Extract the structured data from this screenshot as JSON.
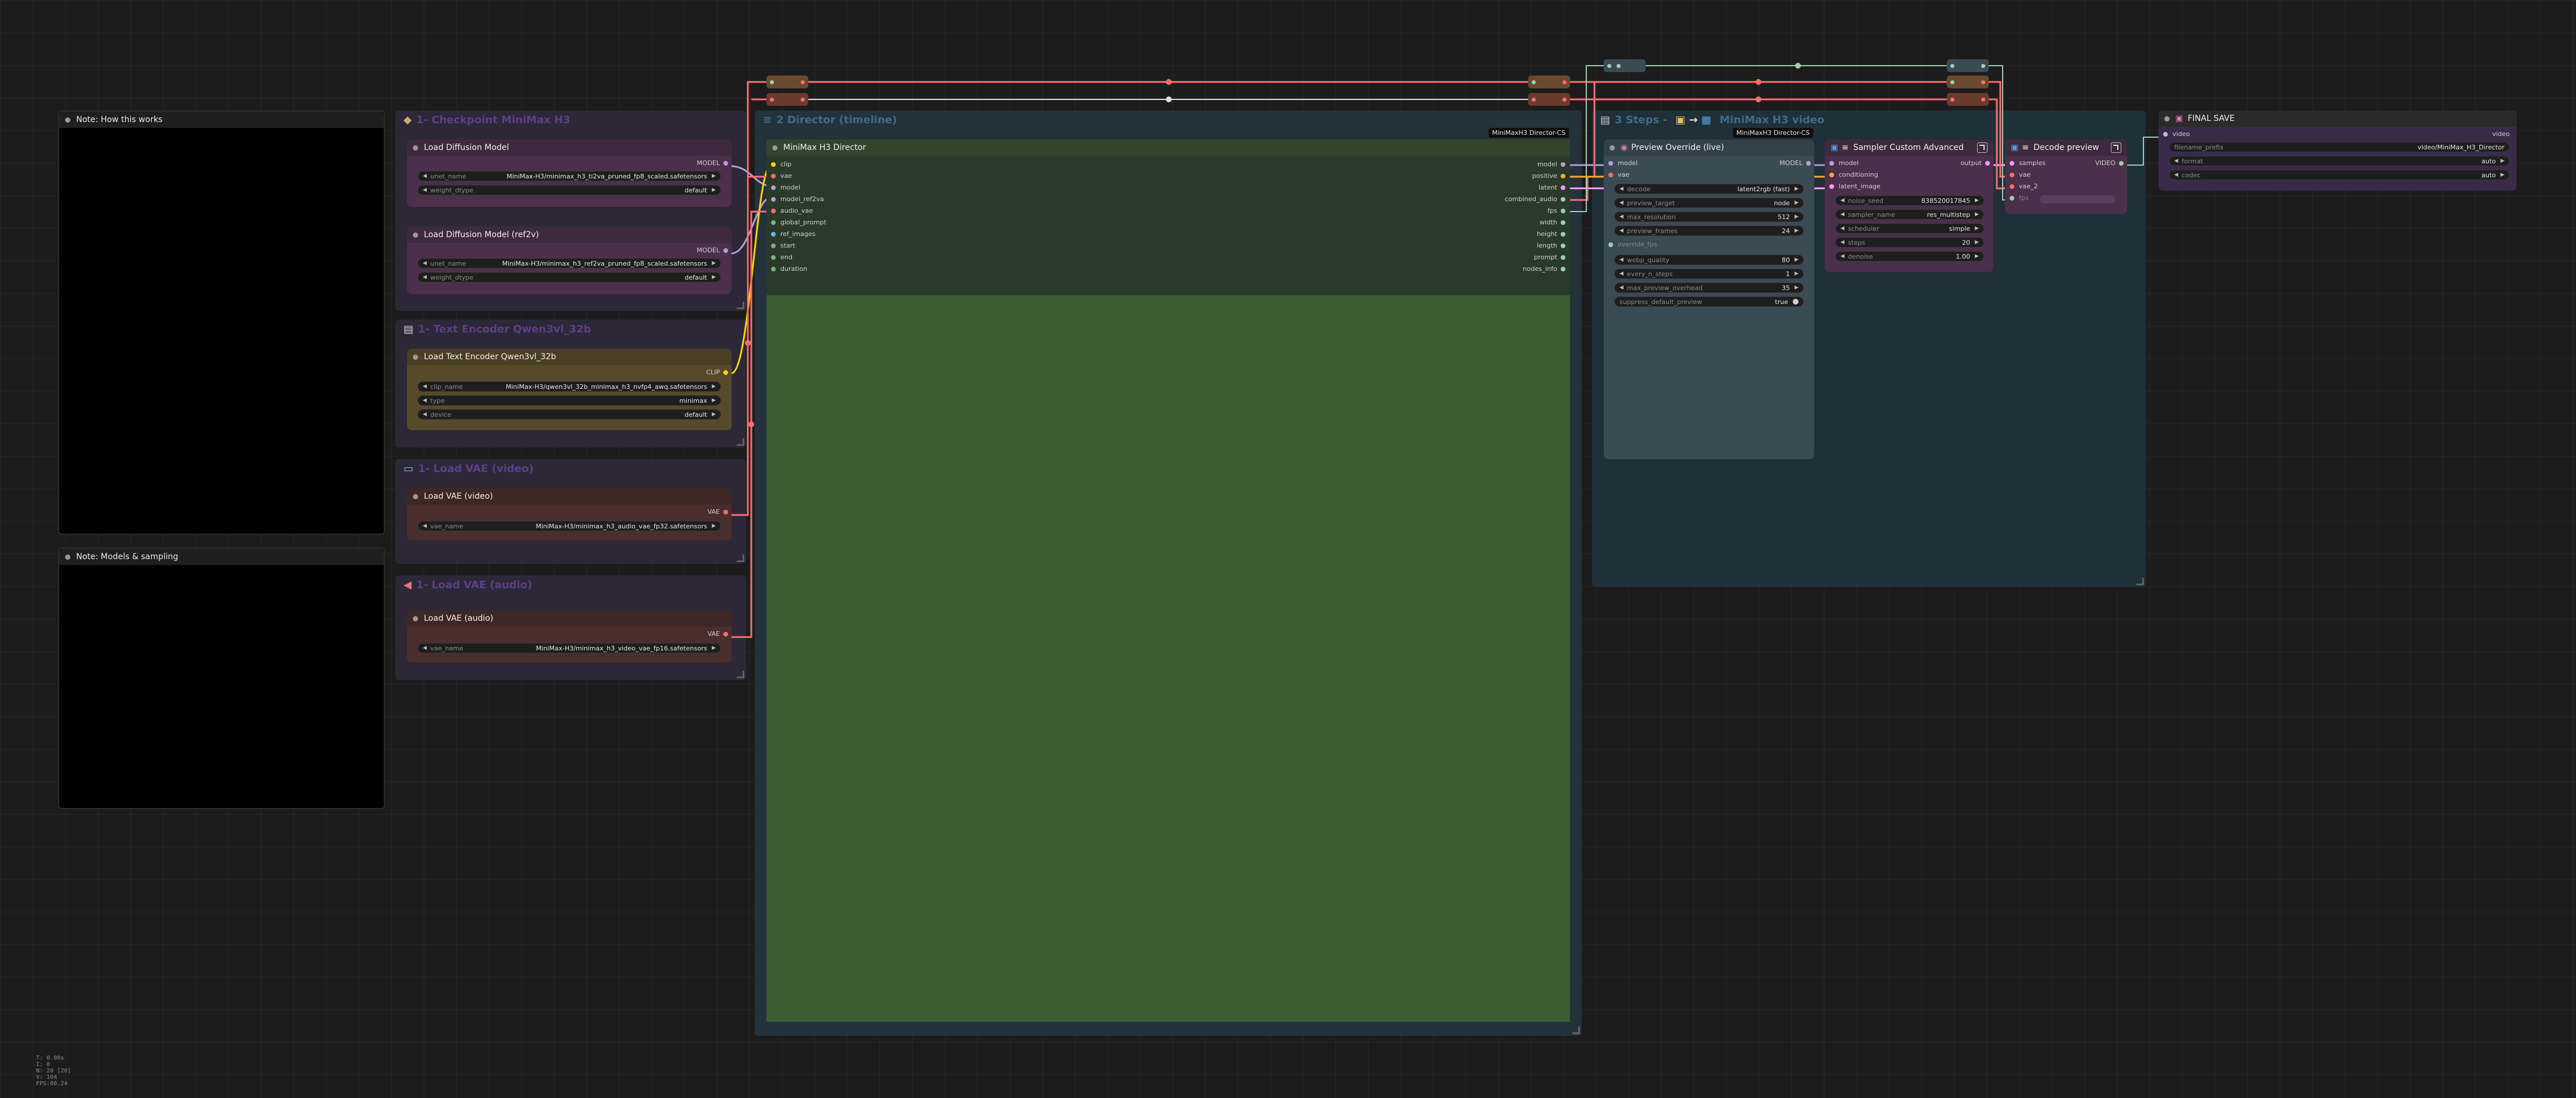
{
  "notes": {
    "how_title": "Note: How this works",
    "models_title": "Note: Models & sampling"
  },
  "groups": {
    "checkpoint": "1- Checkpoint MiniMax H3",
    "text_encoder": "1- Text Encoder Qwen3vl_32b",
    "vae_video": "1- Load VAE (video)",
    "vae_audio": "1- Load VAE (audio)",
    "director": "2 Director (timeline)",
    "steps": "3 Steps -",
    "steps_suffix": "MiniMax H3 video"
  },
  "badges": {
    "director_cs_1": "MiniMaxH3 Director-CS",
    "director_cs_2": "MiniMaxH3 Director-CS"
  },
  "nodes": {
    "load_diffusion": {
      "title": "Load Diffusion Model",
      "output": "MODEL",
      "widgets": [
        {
          "name": "unet_name",
          "value": "MiniMax-H3/minimax_h3_ti2va_pruned_fp8_scaled.safetensors"
        },
        {
          "name": "weight_dtype",
          "value": "default"
        }
      ]
    },
    "load_diffusion_ref": {
      "title": "Load Diffusion Model (ref2v)",
      "output": "MODEL",
      "widgets": [
        {
          "name": "unet_name",
          "value": "MiniMax-H3/minimax_h3_ref2va_pruned_fp8_scaled.safetensors"
        },
        {
          "name": "weight_dtype",
          "value": "default"
        }
      ]
    },
    "text_encoder": {
      "title": "Load Text Encoder Qwen3vl_32b",
      "output": "CLIP",
      "widgets": [
        {
          "name": "clip_name",
          "value": "MiniMax-H3/qwen3vl_32b_minimax_h3_nvfp4_awq.safetensors"
        },
        {
          "name": "type",
          "value": "minimax"
        },
        {
          "name": "device",
          "value": "default"
        }
      ]
    },
    "vae_video": {
      "title": "Load VAE (video)",
      "output": "VAE",
      "widgets": [
        {
          "name": "vae_name",
          "value": "MiniMax-H3/minimax_h3_audio_vae_fp32.safetensors"
        }
      ]
    },
    "vae_audio": {
      "title": "Load VAE (audio)",
      "output": "VAE",
      "widgets": [
        {
          "name": "vae_name",
          "value": "MiniMax-H3/minimax_h3_video_vae_fp16.safetensors"
        }
      ]
    },
    "director": {
      "title": "MiniMax H3 Director",
      "inputs": [
        "clip",
        "vae",
        "model",
        "model_ref2va",
        "audio_vae",
        "global_prompt",
        "ref_images",
        "start",
        "end",
        "duration"
      ],
      "outputs": [
        "model",
        "positive",
        "latent",
        "combined_audio",
        "fps",
        "width",
        "height",
        "length",
        "prompt",
        "nodes_info"
      ]
    },
    "preview": {
      "title": "Preview Override (live)",
      "inputs": [
        "model",
        "vae"
      ],
      "output": "MODEL",
      "widgets": [
        {
          "name": "decode",
          "value": "latent2rgb (fast)"
        },
        {
          "name": "preview_target",
          "value": "node"
        },
        {
          "name": "max_resolution",
          "value": "512"
        },
        {
          "name": "preview_frames",
          "value": "24"
        },
        {
          "name": "override_fps",
          "value": ""
        },
        {
          "name": "webp_quality",
          "value": "80"
        },
        {
          "name": "every_n_steps",
          "value": "1"
        },
        {
          "name": "max_preview_overhead",
          "value": "35"
        },
        {
          "name": "suppress_default_preview",
          "value": "true"
        }
      ]
    },
    "sampler": {
      "title": "Sampler Custom Advanced",
      "inputs": [
        "model",
        "conditioning",
        "latent_image"
      ],
      "output": "output",
      "widgets": [
        {
          "name": "noise_seed",
          "value": "838520017845"
        },
        {
          "name": "sampler_name",
          "value": "res_multistep"
        },
        {
          "name": "scheduler",
          "value": "simple"
        },
        {
          "name": "steps",
          "value": "20"
        },
        {
          "name": "denoise",
          "value": "1.00"
        }
      ]
    },
    "decode": {
      "title": "Decode preview",
      "inputs": [
        "samples",
        "vae",
        "vae_2",
        "fps"
      ],
      "output": "VIDEO"
    },
    "final_save": {
      "title": "FINAL SAVE",
      "input": "video",
      "input_right": "video",
      "widgets": [
        {
          "name": "filename_prefix",
          "value": "video/MiniMax_H3_Director"
        },
        {
          "name": "format",
          "value": "auto"
        },
        {
          "name": "codec",
          "value": "auto"
        }
      ]
    }
  },
  "stats": [
    "T: 0.00s",
    "I: 0",
    "N: 20 [20]",
    "V: 104",
    "FPS:60.24"
  ],
  "colors": {
    "background": "#1c1c1c",
    "model_wire": "#b39ddb",
    "clip_wire": "#ffd500",
    "vae_wire": "#ff6e6e",
    "image_wire": "#64b5f6",
    "latent_wire": "#ff9cf9",
    "video_wire": "#9ad0b0",
    "director_body": "#3d5d33"
  }
}
